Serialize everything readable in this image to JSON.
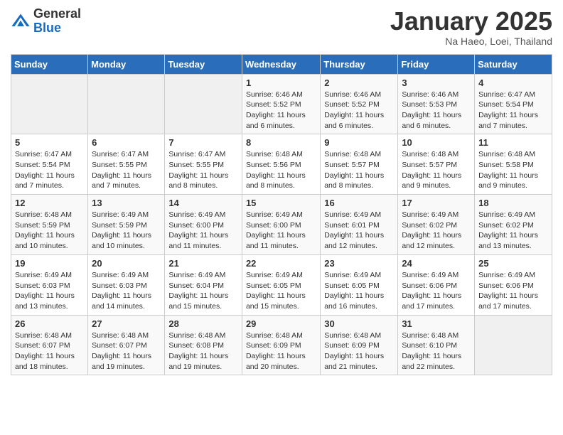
{
  "logo": {
    "general": "General",
    "blue": "Blue"
  },
  "title": "January 2025",
  "location": "Na Haeo, Loei, Thailand",
  "days_of_week": [
    "Sunday",
    "Monday",
    "Tuesday",
    "Wednesday",
    "Thursday",
    "Friday",
    "Saturday"
  ],
  "weeks": [
    [
      {
        "day": "",
        "info": ""
      },
      {
        "day": "",
        "info": ""
      },
      {
        "day": "",
        "info": ""
      },
      {
        "day": "1",
        "info": "Sunrise: 6:46 AM\nSunset: 5:52 PM\nDaylight: 11 hours and 6 minutes."
      },
      {
        "day": "2",
        "info": "Sunrise: 6:46 AM\nSunset: 5:52 PM\nDaylight: 11 hours and 6 minutes."
      },
      {
        "day": "3",
        "info": "Sunrise: 6:46 AM\nSunset: 5:53 PM\nDaylight: 11 hours and 6 minutes."
      },
      {
        "day": "4",
        "info": "Sunrise: 6:47 AM\nSunset: 5:54 PM\nDaylight: 11 hours and 7 minutes."
      }
    ],
    [
      {
        "day": "5",
        "info": "Sunrise: 6:47 AM\nSunset: 5:54 PM\nDaylight: 11 hours and 7 minutes."
      },
      {
        "day": "6",
        "info": "Sunrise: 6:47 AM\nSunset: 5:55 PM\nDaylight: 11 hours and 7 minutes."
      },
      {
        "day": "7",
        "info": "Sunrise: 6:47 AM\nSunset: 5:55 PM\nDaylight: 11 hours and 8 minutes."
      },
      {
        "day": "8",
        "info": "Sunrise: 6:48 AM\nSunset: 5:56 PM\nDaylight: 11 hours and 8 minutes."
      },
      {
        "day": "9",
        "info": "Sunrise: 6:48 AM\nSunset: 5:57 PM\nDaylight: 11 hours and 8 minutes."
      },
      {
        "day": "10",
        "info": "Sunrise: 6:48 AM\nSunset: 5:57 PM\nDaylight: 11 hours and 9 minutes."
      },
      {
        "day": "11",
        "info": "Sunrise: 6:48 AM\nSunset: 5:58 PM\nDaylight: 11 hours and 9 minutes."
      }
    ],
    [
      {
        "day": "12",
        "info": "Sunrise: 6:48 AM\nSunset: 5:59 PM\nDaylight: 11 hours and 10 minutes."
      },
      {
        "day": "13",
        "info": "Sunrise: 6:49 AM\nSunset: 5:59 PM\nDaylight: 11 hours and 10 minutes."
      },
      {
        "day": "14",
        "info": "Sunrise: 6:49 AM\nSunset: 6:00 PM\nDaylight: 11 hours and 11 minutes."
      },
      {
        "day": "15",
        "info": "Sunrise: 6:49 AM\nSunset: 6:00 PM\nDaylight: 11 hours and 11 minutes."
      },
      {
        "day": "16",
        "info": "Sunrise: 6:49 AM\nSunset: 6:01 PM\nDaylight: 11 hours and 12 minutes."
      },
      {
        "day": "17",
        "info": "Sunrise: 6:49 AM\nSunset: 6:02 PM\nDaylight: 11 hours and 12 minutes."
      },
      {
        "day": "18",
        "info": "Sunrise: 6:49 AM\nSunset: 6:02 PM\nDaylight: 11 hours and 13 minutes."
      }
    ],
    [
      {
        "day": "19",
        "info": "Sunrise: 6:49 AM\nSunset: 6:03 PM\nDaylight: 11 hours and 13 minutes."
      },
      {
        "day": "20",
        "info": "Sunrise: 6:49 AM\nSunset: 6:03 PM\nDaylight: 11 hours and 14 minutes."
      },
      {
        "day": "21",
        "info": "Sunrise: 6:49 AM\nSunset: 6:04 PM\nDaylight: 11 hours and 15 minutes."
      },
      {
        "day": "22",
        "info": "Sunrise: 6:49 AM\nSunset: 6:05 PM\nDaylight: 11 hours and 15 minutes."
      },
      {
        "day": "23",
        "info": "Sunrise: 6:49 AM\nSunset: 6:05 PM\nDaylight: 11 hours and 16 minutes."
      },
      {
        "day": "24",
        "info": "Sunrise: 6:49 AM\nSunset: 6:06 PM\nDaylight: 11 hours and 17 minutes."
      },
      {
        "day": "25",
        "info": "Sunrise: 6:49 AM\nSunset: 6:06 PM\nDaylight: 11 hours and 17 minutes."
      }
    ],
    [
      {
        "day": "26",
        "info": "Sunrise: 6:48 AM\nSunset: 6:07 PM\nDaylight: 11 hours and 18 minutes."
      },
      {
        "day": "27",
        "info": "Sunrise: 6:48 AM\nSunset: 6:07 PM\nDaylight: 11 hours and 19 minutes."
      },
      {
        "day": "28",
        "info": "Sunrise: 6:48 AM\nSunset: 6:08 PM\nDaylight: 11 hours and 19 minutes."
      },
      {
        "day": "29",
        "info": "Sunrise: 6:48 AM\nSunset: 6:09 PM\nDaylight: 11 hours and 20 minutes."
      },
      {
        "day": "30",
        "info": "Sunrise: 6:48 AM\nSunset: 6:09 PM\nDaylight: 11 hours and 21 minutes."
      },
      {
        "day": "31",
        "info": "Sunrise: 6:48 AM\nSunset: 6:10 PM\nDaylight: 11 hours and 22 minutes."
      },
      {
        "day": "",
        "info": ""
      }
    ]
  ]
}
